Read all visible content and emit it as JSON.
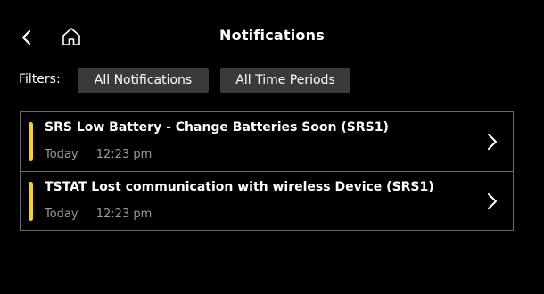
{
  "header": {
    "title": "Notifications",
    "back_icon": "chevron-left-icon",
    "home_icon": "home-icon"
  },
  "filters": {
    "label": "Filters:",
    "chips": [
      {
        "label": "All Notifications"
      },
      {
        "label": "All Time Periods"
      }
    ]
  },
  "notifications": [
    {
      "title": "SRS Low Battery - Change Batteries Soon (SRS1)",
      "date": "Today",
      "time": "12:23 pm",
      "indicator_color": "#f7d417"
    },
    {
      "title": "TSTAT Lost communication with wireless Device (SRS1)",
      "date": "Today",
      "time": "12:23 pm",
      "indicator_color": "#f7d417"
    }
  ],
  "colors": {
    "background": "#000000",
    "chip_background": "#3a3a3a",
    "indicator": "#f7d417",
    "meta_text": "#9a9a9a",
    "border": "#6a6a6a"
  }
}
